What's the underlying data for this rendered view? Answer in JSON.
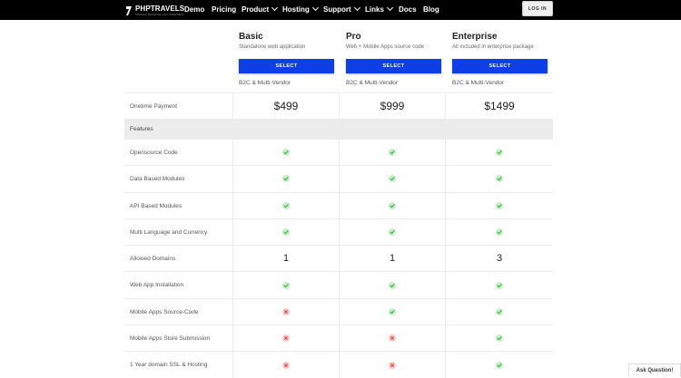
{
  "brand": {
    "name": "PHPTRAVELS",
    "tagline": "TRAVEL TECHNOLOGY PARTNER"
  },
  "nav": [
    {
      "label": "Demo",
      "dropdown": false
    },
    {
      "label": "Pricing",
      "dropdown": false
    },
    {
      "label": "Product",
      "dropdown": true
    },
    {
      "label": "Hosting",
      "dropdown": true
    },
    {
      "label": "Support",
      "dropdown": true
    },
    {
      "label": "Links",
      "dropdown": true
    },
    {
      "label": "Docs",
      "dropdown": false
    },
    {
      "label": "Blog",
      "dropdown": false
    }
  ],
  "login_label": "LOG IN",
  "plans": [
    {
      "name": "Basic",
      "desc": "Standalone web application",
      "button": "SELECT",
      "type": "B2C & Multi-Vendor",
      "price": "$499"
    },
    {
      "name": "Pro",
      "desc": "Web + Mobile Apps source code",
      "button": "SELECT",
      "type": "B2C & Multi-Vendor",
      "price": "$999"
    },
    {
      "name": "Enterprise",
      "desc": "All included in enterprise package",
      "button": "SELECT",
      "type": "B2C & Multi-Vendor",
      "price": "$1499"
    }
  ],
  "price_row_label": "Onetime Payment",
  "features_header": "Features",
  "features": [
    {
      "label": "Opensource Code",
      "values": [
        "check",
        "check",
        "check"
      ]
    },
    {
      "label": "Data Based Modules",
      "values": [
        "check",
        "check",
        "check"
      ]
    },
    {
      "label": "API Based Modules",
      "values": [
        "check",
        "check",
        "check"
      ]
    },
    {
      "label": "Multi Language and Currency",
      "values": [
        "check",
        "check",
        "check"
      ]
    },
    {
      "label": "Allowed Domains",
      "values": [
        "1",
        "1",
        "3"
      ]
    },
    {
      "label": "Web App Installation",
      "values": [
        "check",
        "check",
        "check"
      ]
    },
    {
      "label": "Mobile Apps Source-Code",
      "values": [
        "cross",
        "check",
        "check"
      ]
    },
    {
      "label": "Mobile Apps Store Submission",
      "values": [
        "cross",
        "cross",
        "check"
      ]
    },
    {
      "label": "1 Year domain SSL & Hosting",
      "values": [
        "cross",
        "cross",
        "check"
      ]
    }
  ],
  "ask_question": "Ask Question!",
  "colors": {
    "header_bg": "#000000",
    "select_button": "#0e3fe6",
    "check_green": "#3cb44b",
    "cross_red": "#e04848",
    "features_bg": "#ececec"
  }
}
